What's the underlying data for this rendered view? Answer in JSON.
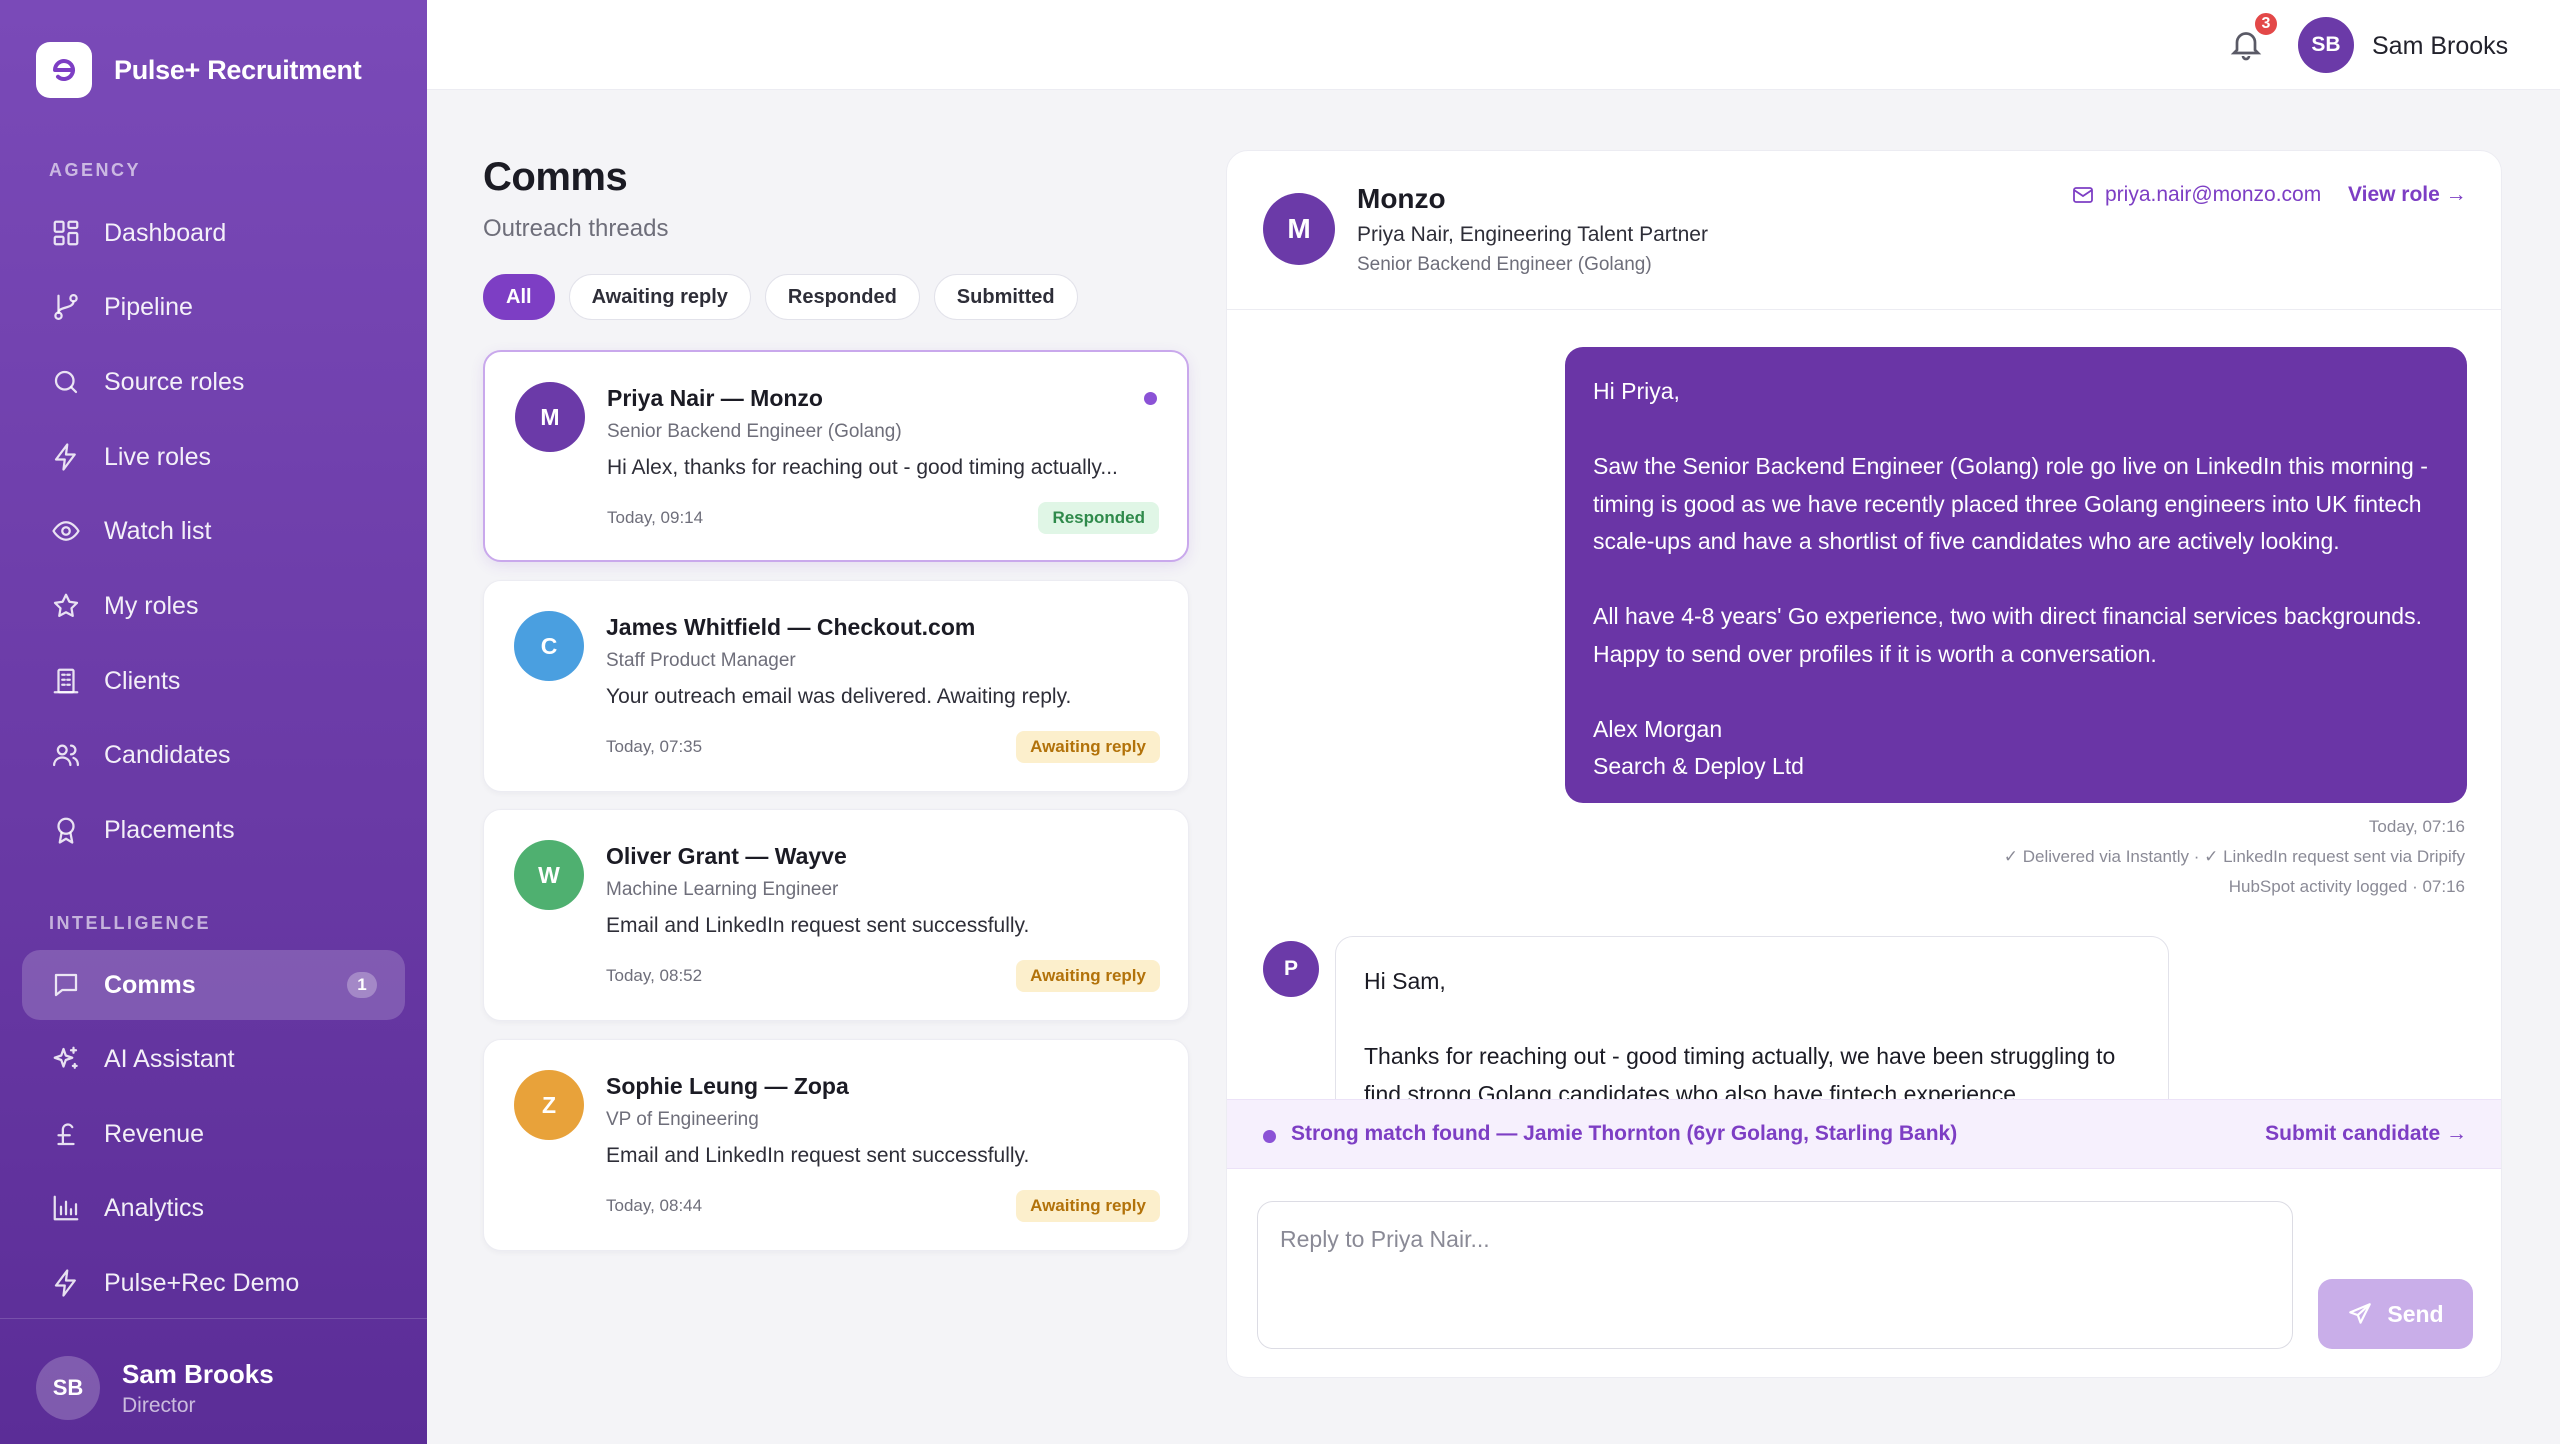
{
  "brand": {
    "name": "Pulse+ Recruitment"
  },
  "sidebar": {
    "section_agency": "AGENCY",
    "section_intelligence": "INTELLIGENCE",
    "items": [
      {
        "label": "Dashboard",
        "icon": "grid-icon"
      },
      {
        "label": "Pipeline",
        "icon": "branch-icon"
      },
      {
        "label": "Source roles",
        "icon": "search-icon"
      },
      {
        "label": "Live roles",
        "icon": "bolt-icon"
      },
      {
        "label": "Watch list",
        "icon": "eye-icon"
      },
      {
        "label": "My roles",
        "icon": "star-icon"
      },
      {
        "label": "Clients",
        "icon": "building-icon"
      },
      {
        "label": "Candidates",
        "icon": "users-icon"
      },
      {
        "label": "Placements",
        "icon": "award-icon"
      },
      {
        "label": "Comms",
        "icon": "message-icon",
        "badge": "1",
        "active": true
      },
      {
        "label": "AI Assistant",
        "icon": "sparkle-icon"
      },
      {
        "label": "Revenue",
        "icon": "pound-icon"
      },
      {
        "label": "Analytics",
        "icon": "bar-chart-icon"
      },
      {
        "label": "Pulse+Rec Demo",
        "icon": "bolt-icon"
      }
    ],
    "user": {
      "initials": "SB",
      "name": "Sam Brooks",
      "role": "Director"
    }
  },
  "topbar": {
    "notifications": "3",
    "user_initials": "SB",
    "user_name": "Sam Brooks"
  },
  "list": {
    "title": "Comms",
    "subtitle": "Outreach threads",
    "filters": [
      "All",
      "Awaiting reply",
      "Responded",
      "Submitted"
    ],
    "threads": [
      {
        "initial": "M",
        "name": "Priya Nair — Monzo",
        "role": "Senior Backend Engineer (Golang)",
        "preview": "Hi Alex, thanks for reaching out - good timing actually...",
        "time": "Today, 09:14",
        "status": "Responded",
        "color": "#6b3aa8"
      },
      {
        "initial": "C",
        "name": "James Whitfield — Checkout.com",
        "role": "Staff Product Manager",
        "preview": "Your outreach email was delivered. Awaiting reply.",
        "time": "Today, 07:35",
        "status": "Awaiting reply",
        "color": "#4a9fe0"
      },
      {
        "initial": "W",
        "name": "Oliver Grant — Wayve",
        "role": "Machine Learning Engineer",
        "preview": "Email and LinkedIn request sent successfully.",
        "time": "Today, 08:52",
        "status": "Awaiting reply",
        "color": "#4fb070"
      },
      {
        "initial": "Z",
        "name": "Sophie Leung — Zopa",
        "role": "VP of Engineering",
        "preview": "Email and LinkedIn request sent successfully.",
        "time": "Today, 08:44",
        "status": "Awaiting reply",
        "color": "#e8a23a"
      }
    ]
  },
  "conversation": {
    "initial": "M",
    "company": "Monzo",
    "contact": "Priya Nair, Engineering Talent Partner",
    "role": "Senior Backend Engineer (Golang)",
    "email": "priya.nair@monzo.com",
    "view_role": "View role →",
    "outgoing": {
      "greeting": "Hi Priya,",
      "para1_l1": "Saw the Senior Backend Engineer (Golang) role go live on LinkedIn this morning -",
      "para1_l2": "timing is good as we have recently placed three Golang engineers into UK fintech",
      "para1_l3": "scale-ups and have a shortlist of five candidates who are actively looking.",
      "para2_l1": "All have 4-8 years' Go experience, two with direct financial services backgrounds.",
      "para2_l2": "Happy to send over profiles if it is worth a conversation.",
      "sign_name": "Alex Morgan",
      "sign_company": "Search & Deploy Ltd"
    },
    "meta_time": "Today, 07:16",
    "meta_delivery": "✓ Delivered via Instantly · ✓ LinkedIn request sent via Dripify",
    "meta_hubspot": "HubSpot activity logged · 07:16",
    "incoming": {
      "initial": "P",
      "greeting": "Hi Sam,",
      "line1": "Thanks for reaching out - good timing actually, we have been struggling to",
      "line2": "find strong Golang candidates who also have fintech experience."
    },
    "match_text": "Strong match found — Jamie Thornton (6yr Golang, Starling Bank)",
    "match_action": "Submit candidate →",
    "reply_placeholder": "Reply to Priya Nair...",
    "send_label": "Send"
  }
}
